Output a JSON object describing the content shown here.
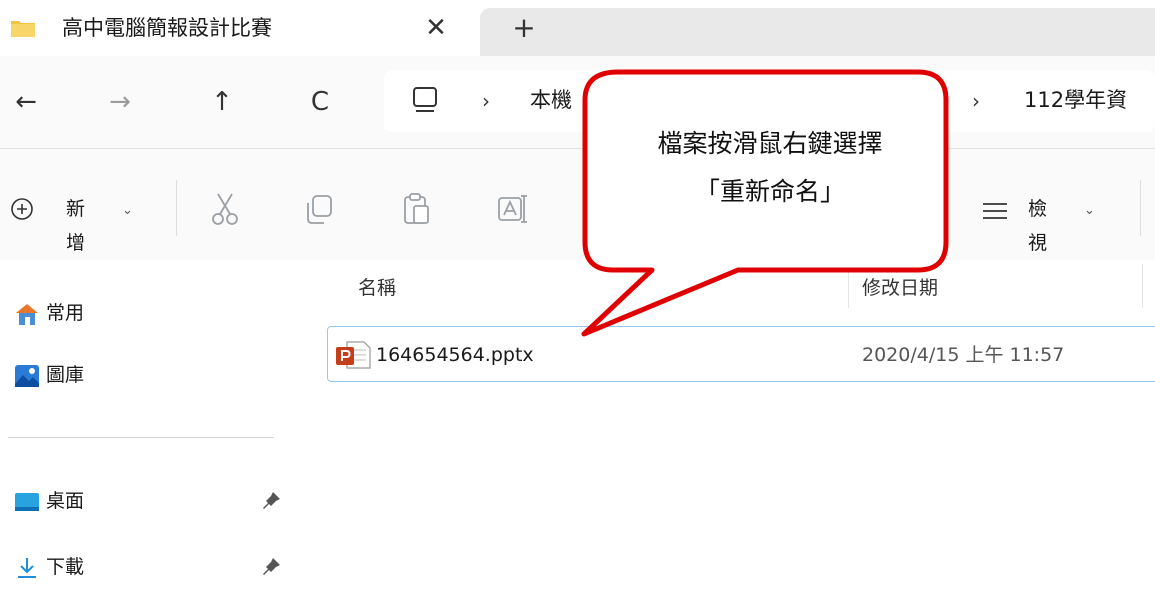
{
  "window": {
    "tab_title": "高中電腦簡報設計比賽",
    "tab_close": "✕",
    "tab_add": "+"
  },
  "nav": {
    "back": "←",
    "forward": "→",
    "up": "↑",
    "refresh": "C",
    "breadcrumb_sep": "›",
    "breadcrumbs": [
      "本機",
      "112學年資"
    ]
  },
  "toolbar": {
    "new_label": "新增",
    "view_label": "檢視",
    "chevron": "⌄"
  },
  "sidebar": {
    "items": [
      {
        "label": "常用",
        "icon": "home-icon"
      },
      {
        "label": "圖庫",
        "icon": "gallery-icon"
      },
      {
        "label": "桌面",
        "icon": "desktop-icon",
        "pinned": true
      },
      {
        "label": "下載",
        "icon": "download-icon",
        "pinned": true
      }
    ]
  },
  "content": {
    "columns": [
      "名稱",
      "修改日期"
    ],
    "files": [
      {
        "name": "164654564.pptx",
        "modified": "2020/4/15 上午 11:57",
        "icon": "powerpoint-file-icon"
      }
    ]
  },
  "callout": {
    "line1": "檔案按滑鼠右鍵選擇",
    "line2": "「重新命名」",
    "border_color": "#e00000"
  },
  "colors": {
    "folder": "#f4c542",
    "accent": "#0067c0",
    "selection_border": "#99c8ef"
  }
}
